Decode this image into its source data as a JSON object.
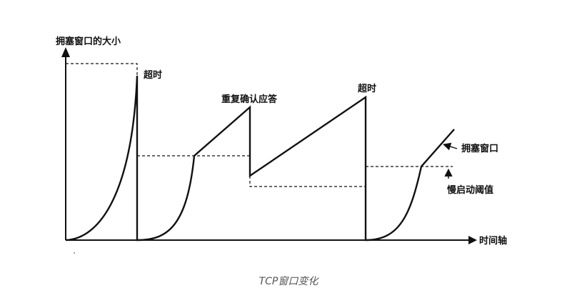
{
  "diagram": {
    "y_axis_label": "拥塞窗口的大小",
    "x_axis_label": "时间轴",
    "annotations": {
      "timeout_1": "超时",
      "triple_dup_ack": "重复确认应答",
      "timeout_2": "超时",
      "cwnd": "拥塞窗口",
      "ssthresh": "慢启动阈值"
    }
  },
  "caption": "TCP窗口变化",
  "colors": {
    "line": "#111111",
    "caption": "#555555",
    "background": "#ffffff"
  }
}
